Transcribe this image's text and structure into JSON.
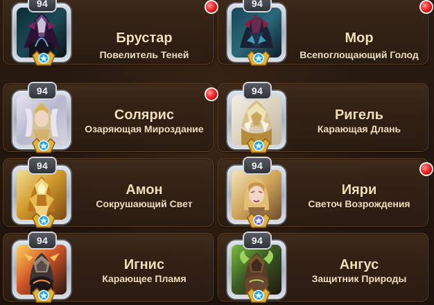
{
  "heroes": [
    {
      "level": "94",
      "name": "Брустар",
      "title": "Повелитель Теней",
      "has_alert": true,
      "portrait_icon": "shadow-warrior-icon",
      "accent": "#4b2b63"
    },
    {
      "level": "94",
      "name": "Мор",
      "title": "Всепоглощающий Голод",
      "has_alert": true,
      "portrait_icon": "dark-beast-icon",
      "accent": "#6a2a4f"
    },
    {
      "level": "94",
      "name": "Солярис",
      "title": "Озаряющая Мироздание",
      "has_alert": true,
      "portrait_icon": "radiant-lady-icon",
      "accent": "#c0a76a"
    },
    {
      "level": "94",
      "name": "Ригель",
      "title": "Карающая Длань",
      "has_alert": false,
      "portrait_icon": "golden-helm-icon",
      "accent": "#d7c18a"
    },
    {
      "level": "94",
      "name": "Амон",
      "title": "Сокрушающий Свет",
      "has_alert": false,
      "portrait_icon": "golden-knight-icon",
      "accent": "#d39b2c"
    },
    {
      "level": "94",
      "name": "Ияри",
      "title": "Светоч Возрождения",
      "has_alert": true,
      "portrait_icon": "blonde-heroine-icon",
      "accent": "#d0a45a"
    },
    {
      "level": "94",
      "name": "Игнис",
      "title": "Карающее Пламя",
      "has_alert": false,
      "portrait_icon": "fire-demon-icon",
      "accent": "#c85b2f"
    },
    {
      "level": "94",
      "name": "Ангус",
      "title": "Защитник Природы",
      "has_alert": false,
      "portrait_icon": "forest-guardian-icon",
      "accent": "#5f8c2b"
    }
  ],
  "colors": {
    "background": "#24170f",
    "card_bg": "#3a2619",
    "card_border": "#966e46",
    "name_text": "#f3dfb8",
    "title_text": "#f3dfc0",
    "alert_red": "#ff3b3b"
  }
}
